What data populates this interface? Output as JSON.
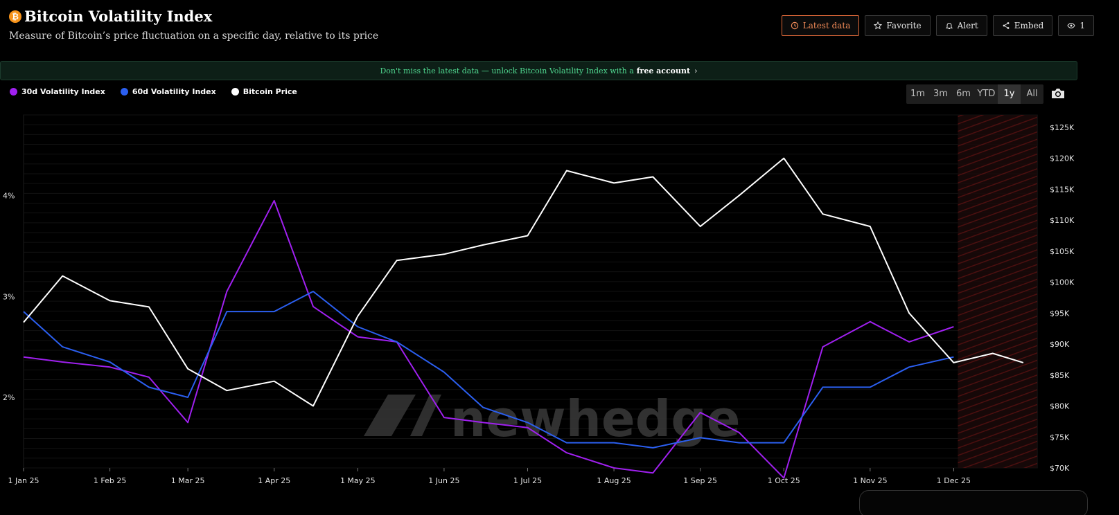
{
  "header": {
    "title": "Bitcoin Volatility Index",
    "subtitle": "Measure of Bitcoin’s price fluctuation on a specific day, relative to its price",
    "btc_badge": "₿"
  },
  "actions": {
    "latest": "Latest data",
    "favorite": "Favorite",
    "alert": "Alert",
    "embed": "Embed",
    "views": "1"
  },
  "banner": {
    "text": "Don't miss the latest data — unlock Bitcoin Volatility Index with a",
    "link": "free account",
    "chevron": "›"
  },
  "ranges": [
    "1m",
    "3m",
    "6m",
    "YTD",
    "1y",
    "All"
  ],
  "active_range": "1y",
  "watermark": "newhedge",
  "colors": {
    "vol30": "#a020f0",
    "vol60": "#2b5ff0",
    "price": "#ffffff",
    "accent": "#f08a57",
    "banner_text": "#50d890"
  },
  "chart_data": {
    "type": "line",
    "x_dates": [
      "2025-01-01",
      "2025-01-15",
      "2025-02-01",
      "2025-02-15",
      "2025-03-01",
      "2025-03-15",
      "2025-04-01",
      "2025-04-15",
      "2025-05-01",
      "2025-05-15",
      "2025-06-01",
      "2025-06-15",
      "2025-07-01",
      "2025-07-15",
      "2025-08-01",
      "2025-08-15",
      "2025-09-01",
      "2025-09-15",
      "2025-10-01",
      "2025-10-15",
      "2025-11-01",
      "2025-11-15",
      "2025-12-01",
      "2025-12-15",
      "2025-12-26"
    ],
    "x_ticks": [
      "1 Jan 25",
      "1 Feb 25",
      "1 Mar 25",
      "1 Apr 25",
      "1 May 25",
      "1 Jun 25",
      "1 Jul 25",
      "1 Aug 25",
      "1 Sep 25",
      "1 Oct 25",
      "1 Nov 25",
      "1 Dec 25"
    ],
    "y_left_ticks": [
      "2%",
      "3%",
      "4%"
    ],
    "y_right_ticks": [
      "$70K",
      "$75K",
      "$80K",
      "$85K",
      "$90K",
      "$95K",
      "$100K",
      "$105K",
      "$110K",
      "$115K",
      "$120K",
      "$125K"
    ],
    "y_left_range": [
      1.3,
      4.8
    ],
    "y_right_range": [
      70000,
      127000
    ],
    "forecast_start": "2025-12-01",
    "series": [
      {
        "name": "30d Volatility Index",
        "axis": "left",
        "color": "#a020f0",
        "values": [
          2.4,
          2.35,
          2.3,
          2.2,
          1.75,
          3.05,
          3.95,
          2.9,
          2.6,
          2.55,
          1.8,
          1.75,
          1.7,
          1.45,
          1.3,
          1.25,
          1.85,
          1.65,
          1.2,
          2.5,
          2.75,
          2.55,
          2.7,
          null,
          null
        ]
      },
      {
        "name": "60d Volatility Index",
        "axis": "left",
        "color": "#2b5ff0",
        "values": [
          2.85,
          2.5,
          2.35,
          2.1,
          2.0,
          2.85,
          2.85,
          3.05,
          2.7,
          2.55,
          2.25,
          1.9,
          1.75,
          1.55,
          1.55,
          1.5,
          1.6,
          1.55,
          1.55,
          2.1,
          2.1,
          2.3,
          2.4,
          null,
          null
        ]
      },
      {
        "name": "Bitcoin Price",
        "axis": "right",
        "color": "#ffffff",
        "values": [
          93500,
          101000,
          97000,
          96000,
          86000,
          82500,
          84000,
          80000,
          94500,
          103500,
          104500,
          106000,
          107500,
          118000,
          116000,
          117000,
          109000,
          114000,
          120000,
          111000,
          109000,
          95000,
          87000,
          88500,
          87000
        ]
      }
    ]
  }
}
